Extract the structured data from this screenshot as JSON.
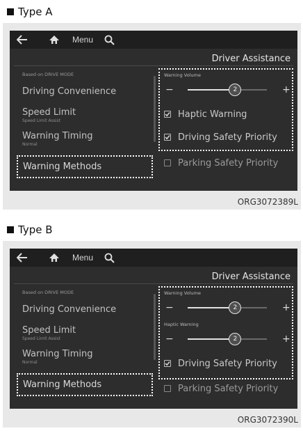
{
  "figures": [
    {
      "heading": "Type A",
      "screen": {
        "menu_label": "Menu",
        "title": "Driver Assistance",
        "mode_caption": "Based on DRIVE MODE",
        "nav": [
          {
            "label": "Driving Convenience",
            "sub": ""
          },
          {
            "label": "Speed Limit",
            "sub": "Speed Limit Assist"
          },
          {
            "label": "Warning Timing",
            "sub": "Normal"
          },
          {
            "label": "Warning Methods",
            "sub": ""
          }
        ],
        "selected_nav": "Warning Methods",
        "sliders": [
          {
            "label": "Warning Volume",
            "value": "2",
            "fraction": 0.6
          }
        ],
        "options": [
          {
            "label": "Haptic Warning",
            "checked": true
          },
          {
            "label": "Driving Safety Priority",
            "checked": true
          },
          {
            "label": "Parking Safety Priority",
            "checked": false
          }
        ]
      },
      "code": "ORG3072389L"
    },
    {
      "heading": "Type B",
      "screen": {
        "menu_label": "Menu",
        "title": "Driver Assistance",
        "mode_caption": "Based on DRIVE MODE",
        "nav": [
          {
            "label": "Driving Convenience",
            "sub": ""
          },
          {
            "label": "Speed Limit",
            "sub": "Speed Limit Assist"
          },
          {
            "label": "Warning Timing",
            "sub": "Normal"
          },
          {
            "label": "Warning Methods",
            "sub": ""
          }
        ],
        "selected_nav": "Warning Methods",
        "sliders": [
          {
            "label": "Warning Volume",
            "value": "2",
            "fraction": 0.6
          },
          {
            "label": "Haptic Warning",
            "value": "2",
            "fraction": 0.6
          }
        ],
        "options": [
          {
            "label": "Driving Safety Priority",
            "checked": true
          },
          {
            "label": "Parking Safety Priority",
            "checked": false
          }
        ]
      },
      "code": "ORG3072390L"
    }
  ],
  "colors": {
    "screen_bg": "#2d2d2d",
    "topbar_bg": "#1f1f1f",
    "highlight_border": "#ffffff",
    "panel_bg": "#e8e8e8"
  },
  "icons": [
    "back-arrow-icon",
    "home-icon",
    "search-icon",
    "checkbox-icon",
    "minus-icon",
    "plus-icon"
  ]
}
